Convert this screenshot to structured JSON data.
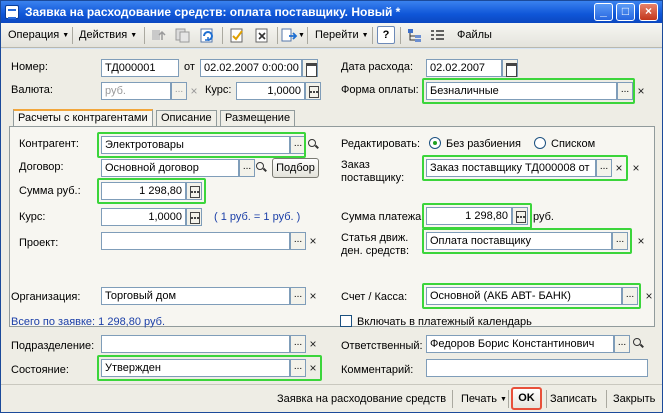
{
  "window": {
    "title": "Заявка на расходование средств: оплата поставщику. Новый *",
    "minimize": "_",
    "maximize": "□",
    "close": "×"
  },
  "toolbar": {
    "operation": "Операция",
    "actions": "Действия",
    "goto": "Перейти",
    "help": "?",
    "files": "Файлы"
  },
  "header": {
    "number_label": "Номер:",
    "number_value": "ТД000001",
    "from_label": "от",
    "date_value": "02.02.2007  0:00:00",
    "expense_date_label": "Дата расхода:",
    "expense_date_value": "02.02.2007",
    "currency_label": "Валюта:",
    "currency_value": "руб.",
    "rate_label": "Курс:",
    "rate_value": "1,0000",
    "payment_form_label": "Форма оплаты:",
    "payment_form_value": "Безналичные"
  },
  "tabs": [
    {
      "label": "Расчеты с контрагентами"
    },
    {
      "label": "Описание"
    },
    {
      "label": "Размещение"
    }
  ],
  "settlements": {
    "counterparty_label": "Контрагент:",
    "counterparty_value": "Электротовары",
    "contract_label": "Договор:",
    "contract_value": "Основной договор",
    "select_button": "Подбор",
    "sum_rub_label": "Сумма руб.:",
    "sum_rub_value": "1 298,80",
    "rate_label": "Курс:",
    "rate_value": "1,0000",
    "rate_hint": "( 1 руб. = 1 руб. )",
    "project_label": "Проект:",
    "project_value": "",
    "edit_label": "Редактировать:",
    "edit_option_1": "Без разбиения",
    "edit_option_2": "Списком",
    "order_label_1": "Заказ",
    "order_label_2": "поставщику:",
    "order_value": "Заказ поставщику ТД000008 от",
    "payment_sum_label": "Сумма платежа:",
    "payment_sum_value": "1 298,80",
    "payment_sum_unit": "руб.",
    "cashflow_label_1": "Статья движ.",
    "cashflow_label_2": "ден. средств:",
    "cashflow_value": "Оплата поставщику"
  },
  "bottom": {
    "org_label": "Организация:",
    "org_value": "Торговый дом",
    "account_label": "Счет / Касса:",
    "account_value": "Основной  (АКБ АВТ- БАНК)",
    "total_text": "Всего по заявке: 1 298,80 руб.",
    "calendar_checkbox": "Включать в платежный календарь",
    "division_label": "Подразделение:",
    "division_value": "",
    "responsible_label": "Ответственный:",
    "responsible_value": "Федоров Борис Константинович",
    "state_label": "Состояние:",
    "state_value": "Утвержден",
    "comment_label": "Комментарий:",
    "comment_value": ""
  },
  "footer": {
    "print_form": "Заявка на расходование средств",
    "print": "Печать",
    "ok": "OK",
    "save": "Записать",
    "close": "Закрыть"
  },
  "colors": {
    "highlight": "#3bd53b",
    "ok_highlight": "#e8503a",
    "title_bar": "#0f56d8"
  }
}
